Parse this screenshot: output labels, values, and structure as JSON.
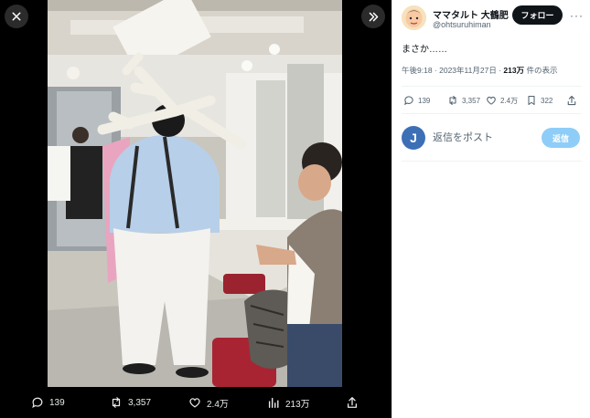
{
  "viewer": {
    "close_icon": "close-icon",
    "expand_icon": "double-chevron-right-icon",
    "actions": {
      "reply_count": "139",
      "repost_count": "3,357",
      "like_count": "2.4万",
      "view_count": "213万"
    }
  },
  "panel": {
    "user": {
      "display_name": "ママタルト 大鶴肥",
      "handle": "@ohtsuruhiman"
    },
    "follow_label": "フォロー",
    "more_label": "···",
    "post_text": "まさか……",
    "meta": {
      "time": "午後9:18",
      "date": "2023年11月27日",
      "views": "213万",
      "views_suffix": " 件の表示"
    },
    "stats": {
      "reply_count": "139",
      "repost_count": "3,357",
      "like_count": "2.4万",
      "bookmark_count": "322"
    },
    "reply": {
      "avatar_letter": "J",
      "placeholder": "返信をポスト",
      "button_label": "返信"
    }
  },
  "colors": {
    "follow_bg": "#0f1419",
    "reply_btn_disabled": "#8ecdf8",
    "my_avatar": "#3d6fb6"
  }
}
